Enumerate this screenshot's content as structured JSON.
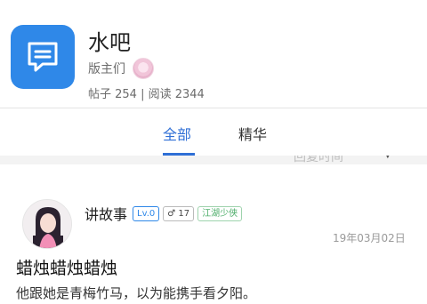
{
  "forum": {
    "icon": "message-square-icon",
    "title": "水吧",
    "moderators_label": "版主们",
    "stats": "帖子 254 | 阅读 2344"
  },
  "tabs": [
    {
      "label": "全部",
      "active": true
    },
    {
      "label": "精华",
      "active": false
    }
  ],
  "sort": {
    "label": "回复时间",
    "icon": "chevron-down-icon"
  },
  "post": {
    "author": "讲故事",
    "level_badge": "Lv.0",
    "gender_badge": "♂ 17",
    "rank_badge": "江湖少侠",
    "date": "19年03月02日",
    "title": "蜡烛蜡烛蜡烛",
    "excerpt": "他跟她是青梅竹马，以为能携手看夕阳。"
  },
  "colors": {
    "accent": "#2f6fd6",
    "forum_icon_bg": "#2f88e8",
    "rank_badge": "#4fae6b"
  }
}
